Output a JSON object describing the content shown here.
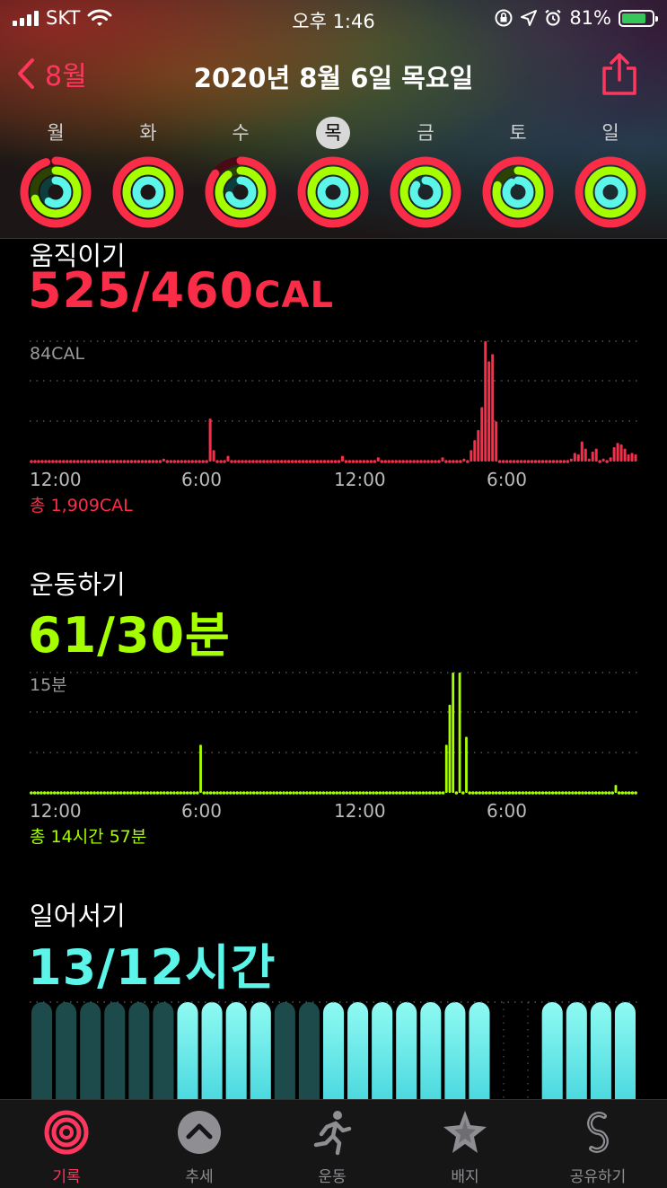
{
  "status_bar": {
    "carrier": "SKT",
    "time": "오후 1:46",
    "battery": "81%",
    "battery_level": 0.81
  },
  "nav": {
    "back_label": "8월",
    "title": "2020년 8월 6일 목요일"
  },
  "week": {
    "days": [
      "월",
      "화",
      "수",
      "목",
      "금",
      "토",
      "일"
    ],
    "selected_index": 3,
    "rings": [
      {
        "move": 0.95,
        "exercise": 0.7,
        "stand": 0.6
      },
      {
        "move": 1.0,
        "exercise": 1.0,
        "stand": 1.0
      },
      {
        "move": 0.85,
        "exercise": 0.9,
        "stand": 0.7
      },
      {
        "move": 1.1,
        "exercise": 1.8,
        "stand": 1.05
      },
      {
        "move": 1.0,
        "exercise": 1.0,
        "stand": 0.85
      },
      {
        "move": 1.0,
        "exercise": 0.8,
        "stand": 0.9
      },
      {
        "move": 1.3,
        "exercise": 1.4,
        "stand": 1.1
      }
    ]
  },
  "move": {
    "title": "움직이기",
    "value": "525/460",
    "unit": "CAL",
    "total": "총 1,909CAL",
    "color": "#fa2d48",
    "chart_data": {
      "type": "bar",
      "ymax_label": "84CAL",
      "ylim": [
        0,
        84
      ],
      "x_tick_labels": [
        "12:00",
        "6:00",
        "12:00",
        "6:00"
      ],
      "values": [
        1,
        1,
        1,
        1,
        1,
        1,
        1,
        1,
        1,
        1,
        1,
        1,
        1,
        1,
        1,
        1,
        1,
        1,
        1,
        1,
        1,
        1,
        1,
        1,
        1,
        1,
        1,
        1,
        1,
        1,
        1,
        1,
        1,
        1,
        1,
        1,
        1,
        2,
        1,
        1,
        1,
        1,
        1,
        1,
        1,
        1,
        1,
        1,
        1,
        1,
        30,
        8,
        1,
        1,
        1,
        4,
        1,
        1,
        1,
        1,
        1,
        1,
        1,
        1,
        1,
        1,
        1,
        1,
        1,
        1,
        1,
        1,
        1,
        1,
        1,
        1,
        1,
        1,
        1,
        1,
        1,
        1,
        1,
        1,
        1,
        1,
        1,
        4,
        1,
        1,
        1,
        1,
        1,
        1,
        1,
        1,
        1,
        3,
        1,
        1,
        1,
        1,
        1,
        1,
        1,
        1,
        1,
        1,
        1,
        1,
        1,
        1,
        1,
        1,
        1,
        3,
        1,
        1,
        1,
        1,
        1,
        2,
        1,
        8,
        15,
        22,
        38,
        84,
        70,
        75,
        28,
        1,
        1,
        1,
        1,
        1,
        1,
        1,
        1,
        1,
        1,
        1,
        1,
        1,
        1,
        1,
        1,
        1,
        1,
        1,
        1,
        2,
        6,
        5,
        14,
        9,
        2,
        7,
        9,
        1,
        2,
        1,
        3,
        10,
        13,
        12,
        9,
        5,
        6,
        5
      ]
    }
  },
  "exercise": {
    "title": "운동하기",
    "value": "61/30",
    "unit": "분",
    "total": "총 14시간 57분",
    "color": "#a6ff00",
    "chart_data": {
      "type": "bar",
      "ymax_label": "15분",
      "ylim": [
        0,
        15
      ],
      "x_tick_labels": [
        "12:00",
        "6:00",
        "12:00",
        "6:00"
      ],
      "values": [
        0,
        0,
        0,
        0,
        0,
        0,
        0,
        0,
        0,
        0,
        0,
        0,
        0,
        0,
        0,
        0,
        0,
        0,
        0,
        0,
        0,
        0,
        0,
        0,
        0,
        0,
        0,
        0,
        0,
        0,
        0,
        0,
        0,
        0,
        0,
        0,
        0,
        0,
        0,
        0,
        0,
        0,
        0,
        0,
        0,
        0,
        0,
        0,
        0,
        0,
        0,
        6,
        0,
        0,
        0,
        0,
        0,
        0,
        0,
        0,
        0,
        0,
        0,
        0,
        0,
        0,
        0,
        0,
        0,
        0,
        0,
        0,
        0,
        0,
        0,
        0,
        0,
        0,
        0,
        0,
        0,
        0,
        0,
        0,
        0,
        0,
        0,
        0,
        0,
        0,
        0,
        0,
        0,
        0,
        0,
        0,
        0,
        0,
        0,
        0,
        0,
        0,
        0,
        0,
        0,
        0,
        0,
        0,
        0,
        0,
        0,
        0,
        0,
        0,
        0,
        0,
        0,
        0,
        0,
        0,
        0,
        0,
        0,
        0,
        0,
        6,
        11,
        15,
        0,
        15,
        0,
        7,
        0,
        0,
        0,
        0,
        0,
        0,
        0,
        0,
        0,
        0,
        0,
        0,
        0,
        0,
        0,
        0,
        0,
        0,
        0,
        0,
        0,
        0,
        0,
        0,
        0,
        0,
        0,
        0,
        0,
        0,
        0,
        0,
        0,
        0,
        0,
        0,
        0,
        0,
        0,
        0,
        0,
        0,
        0,
        0,
        1,
        0,
        0,
        0,
        0,
        0,
        0
      ]
    }
  },
  "stand": {
    "title": "일어서기",
    "value": "13/12",
    "unit": "시간",
    "color": "#5bf5ea",
    "chart_data": {
      "type": "bar",
      "hours": [
        0,
        0,
        0,
        0,
        0,
        0,
        1,
        1,
        1,
        1,
        0,
        0,
        1,
        1,
        1,
        1,
        1,
        1,
        1,
        -1,
        -1,
        1,
        1,
        1,
        1
      ]
    }
  },
  "tabs": [
    {
      "label": "기록",
      "icon": "activity-rings-icon"
    },
    {
      "label": "추세",
      "icon": "trends-icon"
    },
    {
      "label": "운동",
      "icon": "running-figure-icon"
    },
    {
      "label": "배지",
      "icon": "award-badge-icon"
    },
    {
      "label": "공유하기",
      "icon": "sharing-icon"
    }
  ],
  "colors": {
    "accent": "#ff375f",
    "move": "#fa2d48",
    "exercise": "#a6ff00",
    "stand": "#5bf5ea"
  }
}
